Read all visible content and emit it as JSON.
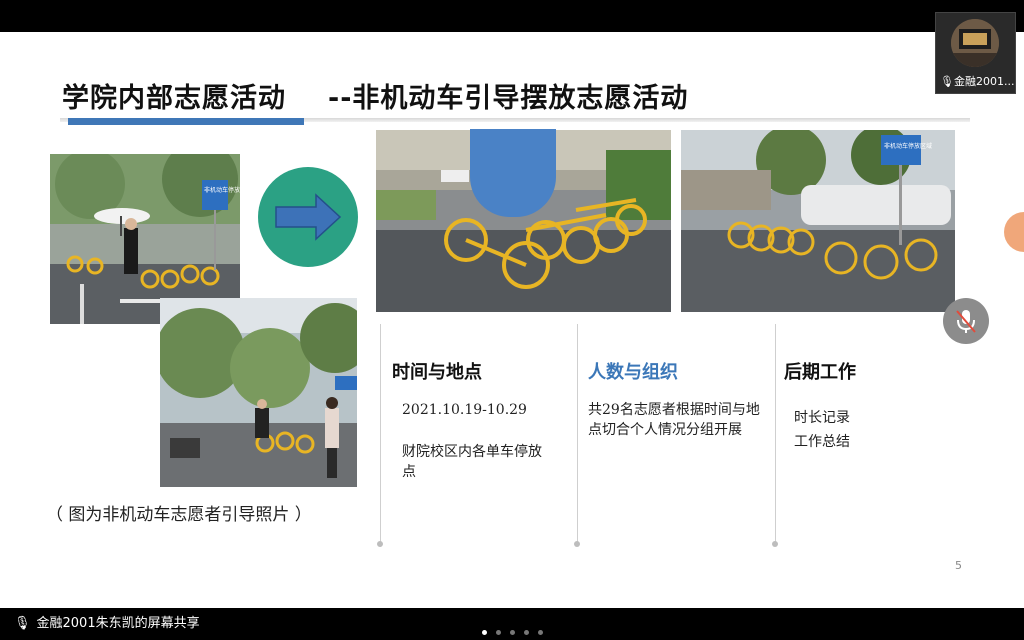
{
  "slide": {
    "title": "学院内部志愿活动",
    "subtitle": "--非机动车引导摆放志愿活动",
    "caption": "（ 图为非机动车志愿者引导照片 ）",
    "page_number": "5",
    "columns": [
      {
        "heading": "时间与地点",
        "lines": [
          "2021.10.19-10.29",
          "财院校区内各单车停放点"
        ]
      },
      {
        "heading": "人数与组织",
        "lines": [
          "共29名志愿者根据时间与地点切合个人情况分组开展"
        ]
      },
      {
        "heading": "后期工作",
        "lines": [
          "时长记录",
          "工作总结"
        ]
      }
    ],
    "photos": {
      "photo1_sign": "非机动车停放区域",
      "photo4_sign": "非机动车停放区域"
    }
  },
  "meeting": {
    "participant_label": "金融2001...",
    "share_label": "金融2001朱东凯的屏幕共享",
    "page_dots": 5,
    "active_dot": 0
  },
  "colors": {
    "accent_blue": "#3f77b7",
    "arrow_circle": "#2ba184",
    "heading_blue": "#3b77b8"
  }
}
